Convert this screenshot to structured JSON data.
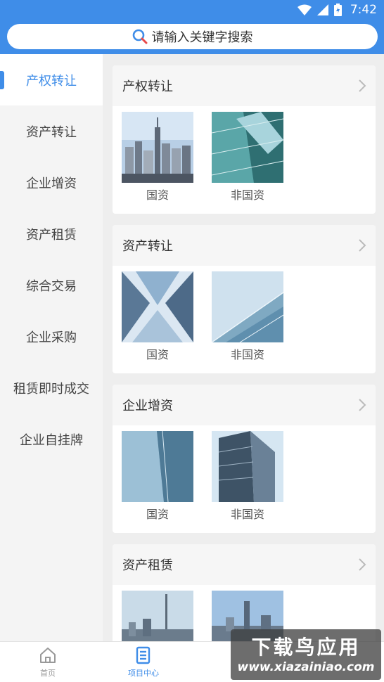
{
  "status_bar": {
    "time": "7:42"
  },
  "search": {
    "placeholder": "请输入关键字搜索"
  },
  "sidebar": {
    "items": [
      {
        "label": "产权转让",
        "active": true
      },
      {
        "label": "资产转让",
        "active": false
      },
      {
        "label": "企业增资",
        "active": false
      },
      {
        "label": "资产租赁",
        "active": false
      },
      {
        "label": "综合交易",
        "active": false
      },
      {
        "label": "企业采购",
        "active": false
      },
      {
        "label": "租赁即时成交",
        "active": false
      },
      {
        "label": "企业自挂牌",
        "active": false
      }
    ]
  },
  "sections": [
    {
      "title": "产权转让",
      "tiles": [
        {
          "label": "国资"
        },
        {
          "label": "非国资"
        }
      ]
    },
    {
      "title": "资产转让",
      "tiles": [
        {
          "label": "国资"
        },
        {
          "label": "非国资"
        }
      ]
    },
    {
      "title": "企业增资",
      "tiles": [
        {
          "label": "国资"
        },
        {
          "label": "非国资"
        }
      ]
    },
    {
      "title": "资产租赁",
      "tiles": [
        {
          "label": ""
        },
        {
          "label": ""
        }
      ]
    }
  ],
  "bottom_nav": {
    "items": [
      {
        "label": "首页",
        "icon": "home-icon",
        "active": false
      },
      {
        "label": "项目中心",
        "icon": "document-icon",
        "active": true
      }
    ]
  },
  "watermark": {
    "title": "下载鸟应用",
    "url": "www.xiazainiao.com"
  },
  "colors": {
    "accent": "#3f8de8",
    "sidebar_bg": "#f4f4f4",
    "content_bg": "#eeeeee"
  }
}
